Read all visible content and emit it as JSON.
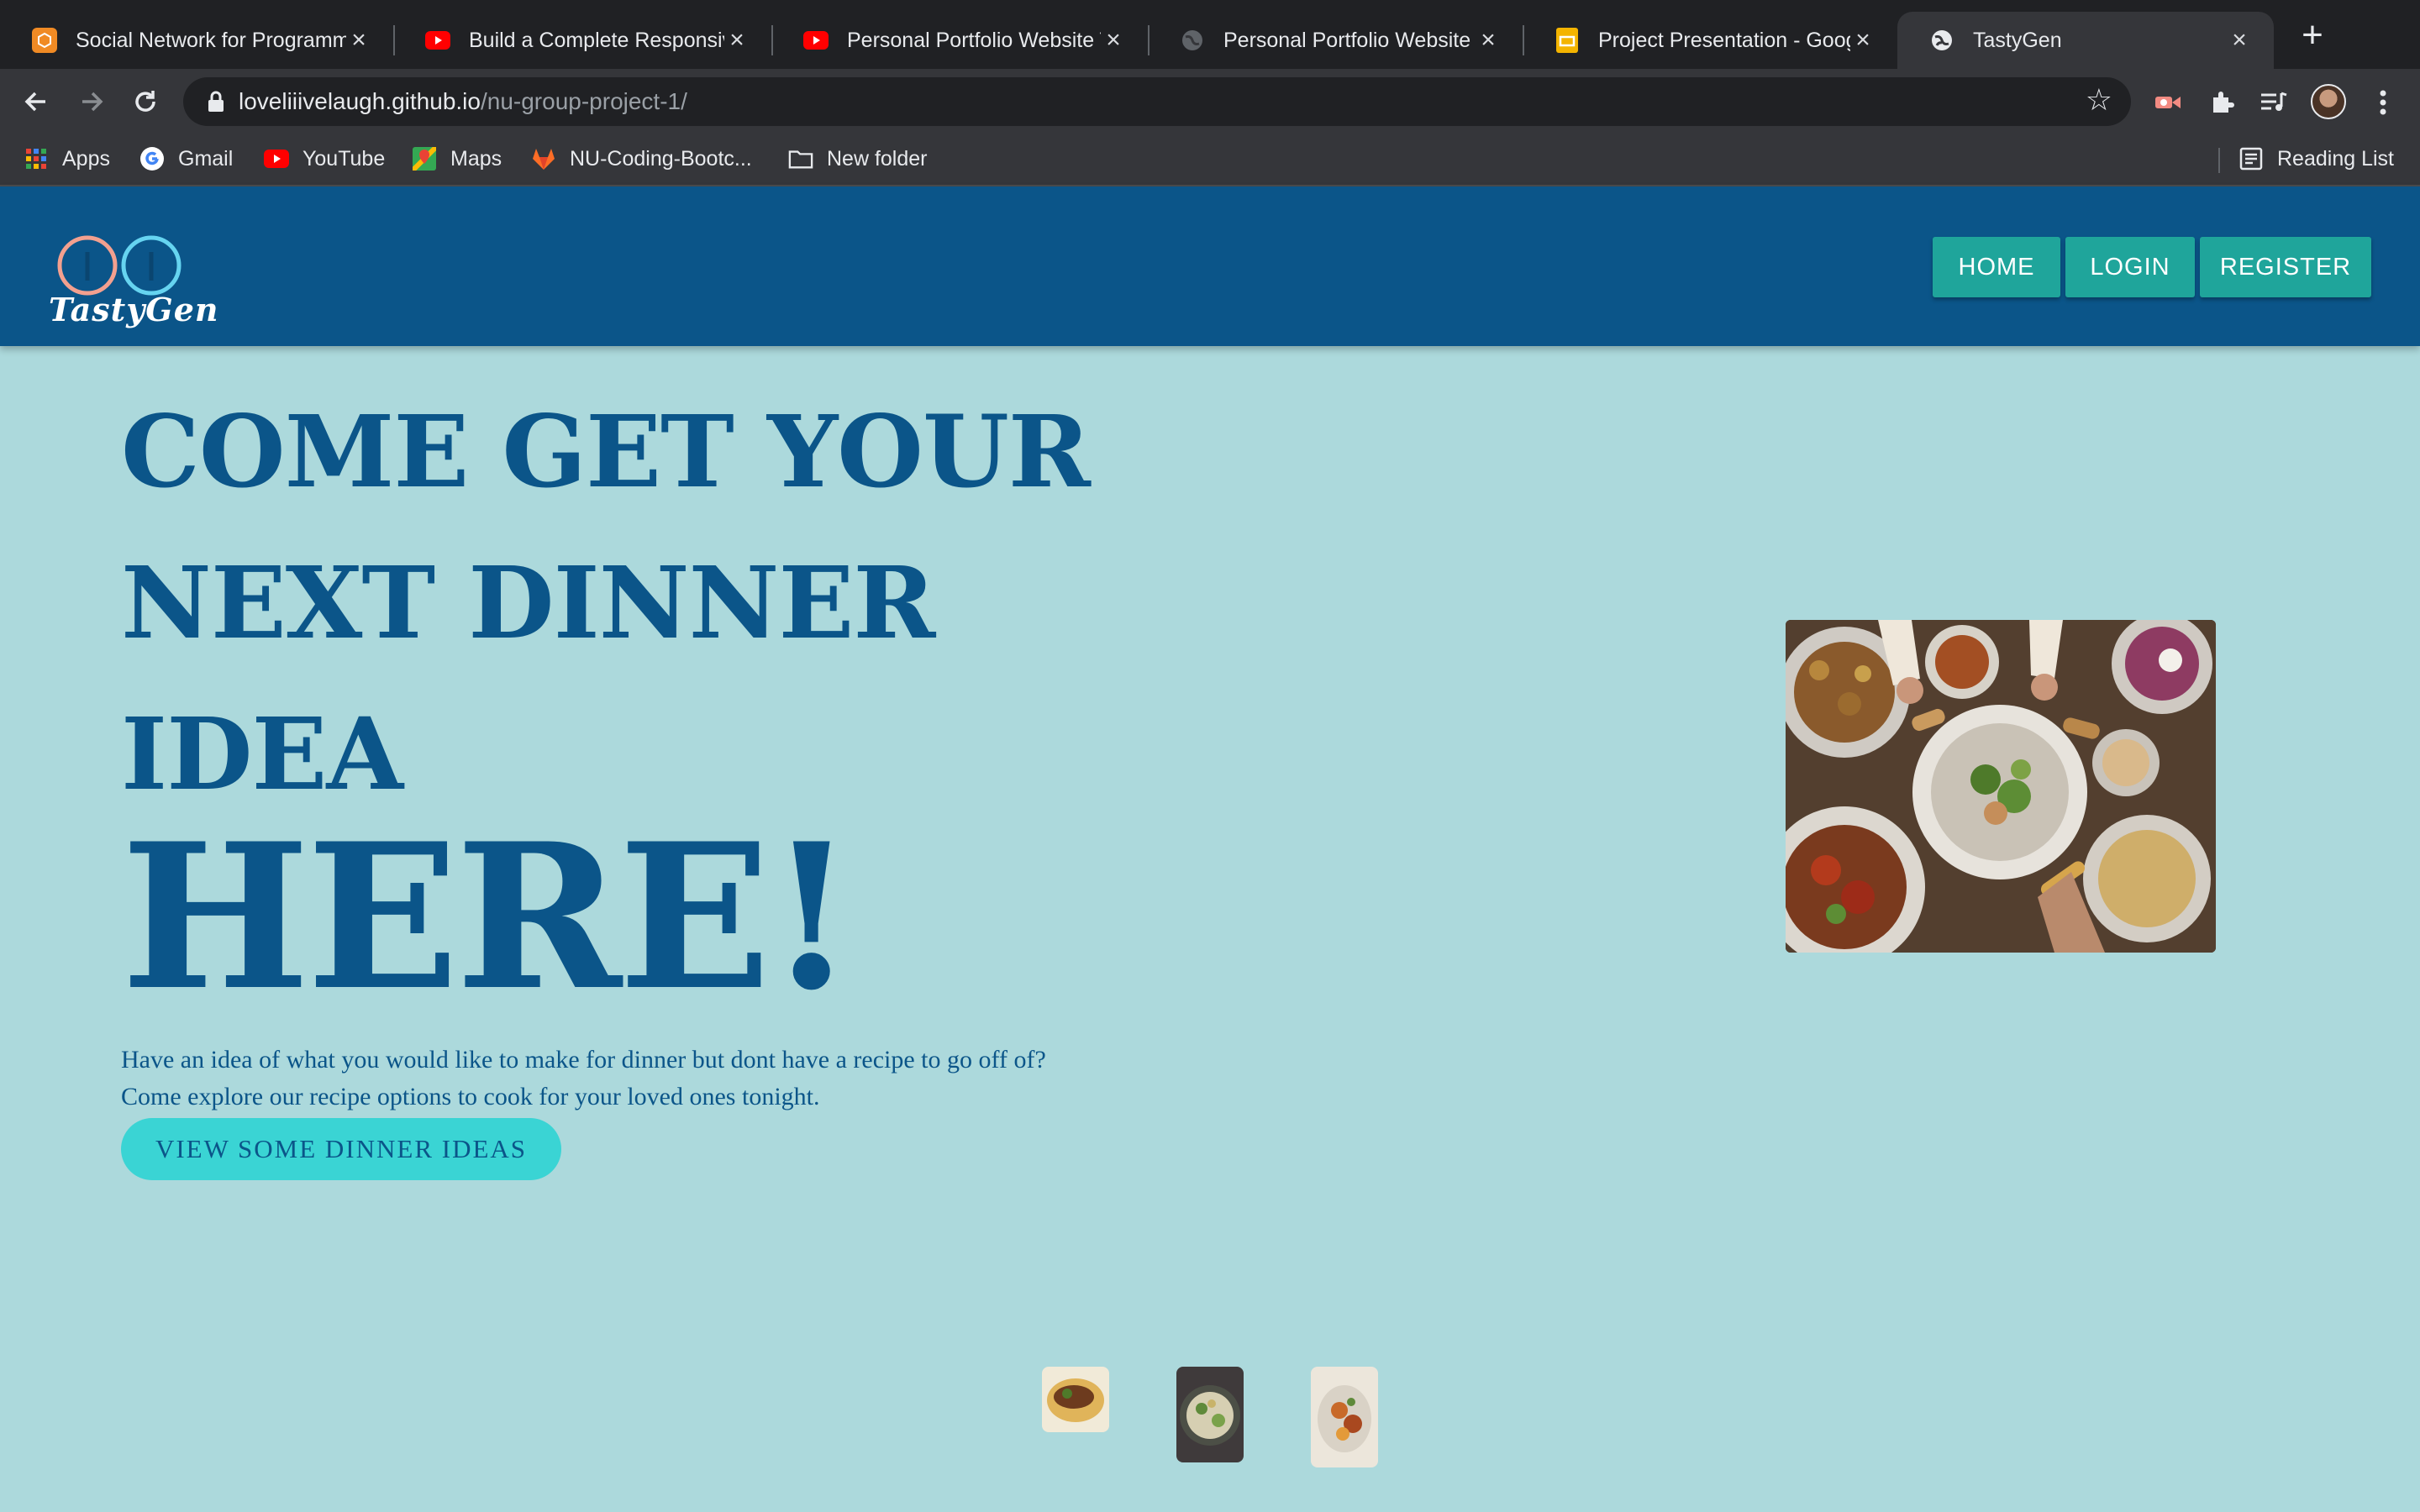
{
  "browser": {
    "tabs": [
      {
        "title": "Social Network for Programm",
        "icon": "devconnector-icon",
        "active": false
      },
      {
        "title": "Build a Complete Responsive",
        "icon": "youtube-icon",
        "active": false
      },
      {
        "title": "Personal Portfolio Website T",
        "icon": "youtube-icon",
        "active": false
      },
      {
        "title": "Personal Portfolio Website",
        "icon": "globe-icon",
        "active": false
      },
      {
        "title": "Project Presentation - Googl",
        "icon": "slides-icon",
        "active": false
      },
      {
        "title": "TastyGen",
        "icon": "globe-icon",
        "active": true
      }
    ],
    "url_domain": "loveliiivelaugh.github.io",
    "url_path": "/nu-group-project-1/",
    "bookmarks": [
      "Apps",
      "Gmail",
      "YouTube",
      "Maps",
      "NU-Coding-Bootc...",
      "New folder"
    ],
    "reading_list": "Reading List"
  },
  "site": {
    "logo_text": "TastyGen",
    "nav": [
      "HOME",
      "LOGIN",
      "REGISTER"
    ],
    "headline": [
      "COME GET YOUR",
      "NEXT DINNER",
      "IDEA",
      "HERE!"
    ],
    "intro_line1": "Have an idea of what you would like to make for dinner but dont have a recipe to go off of?",
    "intro_line2": "Come explore our recipe options to cook for your loved ones tonight.",
    "cta": "VIEW SOME DINNER IDEAS"
  },
  "colors": {
    "header_bg": "#0b5589",
    "page_bg": "#acd9dc",
    "nav_button": "#1fa59b",
    "cta_button": "#3ad4d4",
    "headline": "#0b5589"
  }
}
